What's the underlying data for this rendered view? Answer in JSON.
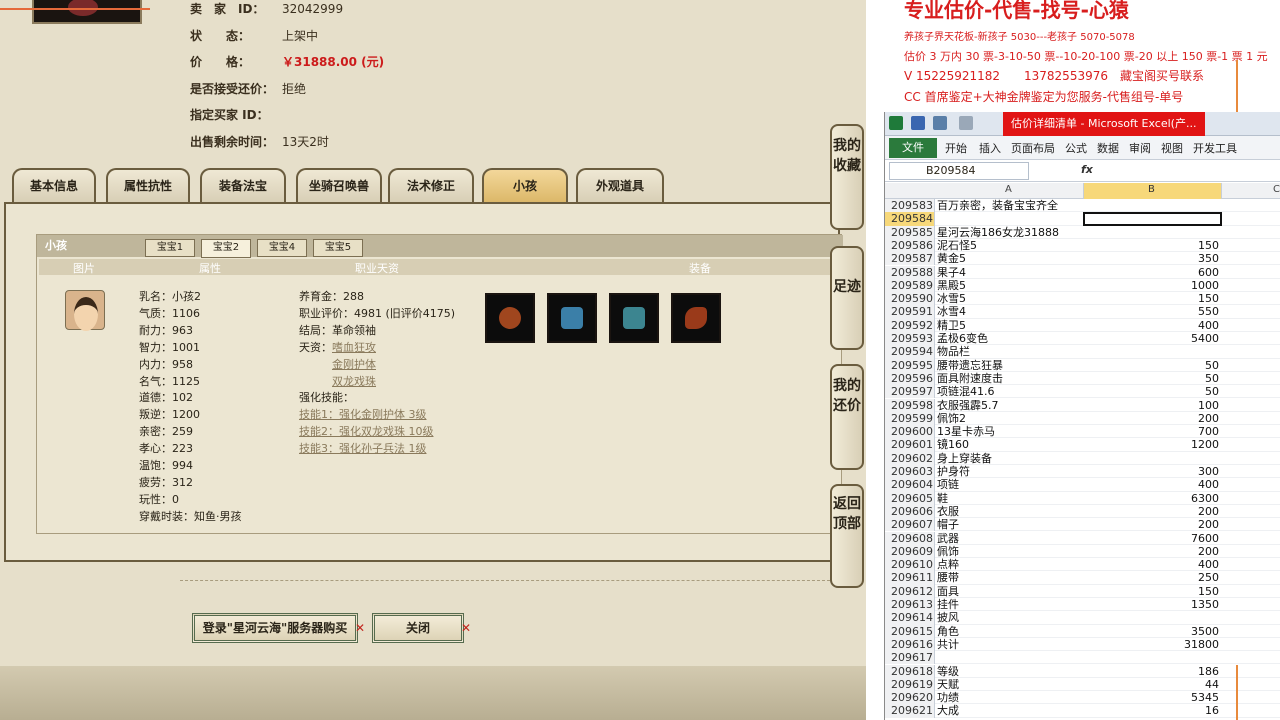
{
  "game": {
    "sale": {
      "seller_label": "卖　家　ID：",
      "seller_value": "32042999",
      "status_label": "状　　态：",
      "status_value": "上架中",
      "price_label": "价　　格：",
      "price_value": "￥31888.00 (元)",
      "counter_label": "是否接受还价：",
      "counter_value": "拒绝",
      "buyer_label": "指定买家 ID：",
      "buyer_value": "",
      "remain_label": "出售剩余时间：",
      "remain_value": "13天2时"
    },
    "tabs": [
      "基本信息",
      "属性抗性",
      "装备法宝",
      "坐骑召唤兽",
      "法术修正",
      "小孩",
      "外观道具"
    ],
    "child_panel": {
      "title": "小孩",
      "subtabs": [
        "宝宝1",
        "宝宝2",
        "宝宝4",
        "宝宝5"
      ],
      "columns": [
        "图片",
        "属性",
        "职业天资",
        "装备"
      ],
      "attributes": [
        "乳名：小孩2",
        "气质：1106",
        "耐力：963",
        "智力：1001",
        "内力：958",
        "名气：1125",
        "道德：102",
        "叛逆：1200",
        "亲密：259",
        "孝心：223",
        "温饱：994",
        "疲劳：312",
        "玩性：0",
        "穿戴时装：知鱼·男孩"
      ],
      "talent": {
        "yang": "养育金：288",
        "eval": "职业评价：4981 (旧评价4175)",
        "ending": "结局：革命领袖",
        "tianzi_label": "天资：",
        "tianzi": [
          "嗜血狂攻",
          "金刚护体",
          "双龙戏珠"
        ],
        "skill_label": "强化技能：",
        "skills": [
          "技能1：强化金刚护体 3级",
          "技能2：强化双龙戏珠 10级",
          "技能3：强化孙子兵法 1级"
        ]
      },
      "equip_icons": [
        "belt-icon",
        "robe-icon",
        "cloth-icon",
        "boots-icon"
      ]
    },
    "buttons": {
      "login": "登录\"星河云海\"服务器购买",
      "close": "关闭"
    },
    "side_buttons": [
      "我的收藏",
      "足迹",
      "我的还价",
      "返回顶部"
    ]
  },
  "notes": {
    "title": "专业估价-代售-找号-心猿",
    "lines": [
      "养孩子界天花板-新孩子 5030---老孩子 5070-5078",
      "估价 3 万内 30 票-3-10-50 票--10-20-100 票-20 以上 150 票-1 票 1 元",
      "V 15225921182　　13782553976　藏宝阁买号联系",
      "CC 首席鉴定+大神金牌鉴定为您服务-代售组号-单号"
    ]
  },
  "excel": {
    "title": "估价详细清单 - Microsoft Excel(产...",
    "file_tab": "文件",
    "menus": [
      "开始",
      "插入",
      "页面布局",
      "公式",
      "数据",
      "审阅",
      "视图",
      "开发工具"
    ],
    "namebox": "B209584",
    "fx": "fx",
    "col_a": "A",
    "col_b": "B",
    "col_c": "C",
    "rows": [
      {
        "n": "209583",
        "a": "百万亲密，装备宝宝齐全",
        "b": ""
      },
      {
        "n": "209584",
        "a": "",
        "b": ""
      },
      {
        "n": "209585",
        "a": "星河云海186女龙31888",
        "b": ""
      },
      {
        "n": "209586",
        "a": "泥石怪5",
        "b": "150"
      },
      {
        "n": "209587",
        "a": "黄金5",
        "b": "350"
      },
      {
        "n": "209588",
        "a": "果子4",
        "b": "600"
      },
      {
        "n": "209589",
        "a": "黑殿5",
        "b": "1000"
      },
      {
        "n": "209590",
        "a": "冰雪5",
        "b": "150"
      },
      {
        "n": "209591",
        "a": "冰雪4",
        "b": "550"
      },
      {
        "n": "209592",
        "a": "精卫5",
        "b": "400"
      },
      {
        "n": "209593",
        "a": "孟极6变色",
        "b": "5400"
      },
      {
        "n": "209594",
        "a": "物品栏",
        "b": ""
      },
      {
        "n": "209595",
        "a": "腰带遗忘狂暴",
        "b": "50"
      },
      {
        "n": "209596",
        "a": "面具附速度击",
        "b": "50"
      },
      {
        "n": "209597",
        "a": "项链混41.6",
        "b": "50"
      },
      {
        "n": "209598",
        "a": "衣服强霹5.7",
        "b": "100"
      },
      {
        "n": "209599",
        "a": "佩饰2",
        "b": "200"
      },
      {
        "n": "209600",
        "a": "13星卡赤马",
        "b": "700"
      },
      {
        "n": "209601",
        "a": "镜160",
        "b": "1200"
      },
      {
        "n": "209602",
        "a": "身上穿装备",
        "b": ""
      },
      {
        "n": "209603",
        "a": "护身符",
        "b": "300"
      },
      {
        "n": "209604",
        "a": "项链",
        "b": "400"
      },
      {
        "n": "209605",
        "a": "鞋",
        "b": "6300"
      },
      {
        "n": "209606",
        "a": "衣服",
        "b": "200"
      },
      {
        "n": "209607",
        "a": "帽子",
        "b": "200"
      },
      {
        "n": "209608",
        "a": "武器",
        "b": "7600"
      },
      {
        "n": "209609",
        "a": "佩饰",
        "b": "200"
      },
      {
        "n": "209610",
        "a": "点粹",
        "b": "400"
      },
      {
        "n": "209611",
        "a": "腰带",
        "b": "250"
      },
      {
        "n": "209612",
        "a": "面具",
        "b": "150"
      },
      {
        "n": "209613",
        "a": "挂件",
        "b": "1350"
      },
      {
        "n": "209614",
        "a": "披风",
        "b": ""
      },
      {
        "n": "209615",
        "a": "角色",
        "b": "3500"
      },
      {
        "n": "209616",
        "a": "共计",
        "b": "31800"
      },
      {
        "n": "209617",
        "a": "",
        "b": ""
      },
      {
        "n": "209618",
        "a": "等级",
        "b": "186"
      },
      {
        "n": "209619",
        "a": "天赋",
        "b": "44"
      },
      {
        "n": "209620",
        "a": "功绩",
        "b": "5345"
      },
      {
        "n": "209621",
        "a": "大成",
        "b": "16"
      }
    ]
  }
}
